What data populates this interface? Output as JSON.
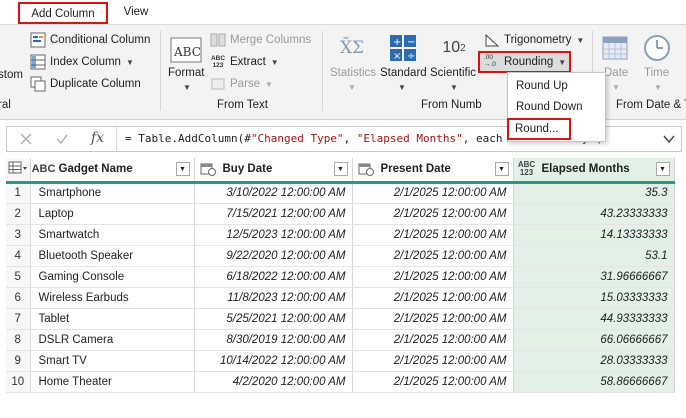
{
  "tabs": {
    "add_column": "Add Column",
    "view": "View"
  },
  "ribbon": {
    "general": {
      "custom_partial": "stom",
      "group_partial": "ral"
    },
    "column_items": {
      "conditional": "Conditional Column",
      "index": "Index Column",
      "duplicate": "Duplicate Column"
    },
    "from_text": {
      "format": "Format",
      "merge": "Merge Columns",
      "extract": "Extract",
      "parse": "Parse",
      "group": "From Text",
      "abc_top": "ABC",
      "abc_num": "123"
    },
    "from_number": {
      "statistics": "Statistics",
      "standard": "Standard",
      "scientific": "Scientific",
      "trigonometry": "Trigonometry",
      "rounding": "Rounding",
      "group": "From Numb",
      "sci_glyph": "10",
      "sci_exp": "2",
      "xo_glyph": "X̄Σ",
      "round_glyph_top": ".00",
      "round_glyph_bot": "→.0"
    },
    "from_date": {
      "date": "Date",
      "time": "Time",
      "group": "From Date & T"
    }
  },
  "dropdown": {
    "round_up": "Round Up",
    "round_down": "Round Down",
    "round": "Round..."
  },
  "formula_bar": {
    "fx": "fx",
    "prefix": "= Table.AddColumn(#",
    "arg1": "\"Changed Type\"",
    "sep1": ", ",
    "arg2": "\"Elapsed Months\"",
    "sep2": ", each Duration.Days("
  },
  "table": {
    "columns": [
      {
        "type": "ABC",
        "name": "Gadget Name"
      },
      {
        "type": "date",
        "name": "Buy Date"
      },
      {
        "type": "date",
        "name": "Present Date"
      },
      {
        "type": "ABC123",
        "name": "Elapsed Months"
      }
    ],
    "rows": [
      {
        "n": "1",
        "name": "Smartphone",
        "buy": "3/10/2022 12:00:00 AM",
        "present": "2/1/2025 12:00:00 AM",
        "months": "35.3"
      },
      {
        "n": "2",
        "name": "Laptop",
        "buy": "7/15/2021 12:00:00 AM",
        "present": "2/1/2025 12:00:00 AM",
        "months": "43.23333333"
      },
      {
        "n": "3",
        "name": "Smartwatch",
        "buy": "12/5/2023 12:00:00 AM",
        "present": "2/1/2025 12:00:00 AM",
        "months": "14.13333333"
      },
      {
        "n": "4",
        "name": "Bluetooth Speaker",
        "buy": "9/22/2020 12:00:00 AM",
        "present": "2/1/2025 12:00:00 AM",
        "months": "53.1"
      },
      {
        "n": "5",
        "name": "Gaming Console",
        "buy": "6/18/2022 12:00:00 AM",
        "present": "2/1/2025 12:00:00 AM",
        "months": "31.96666667"
      },
      {
        "n": "6",
        "name": "Wireless Earbuds",
        "buy": "11/8/2023 12:00:00 AM",
        "present": "2/1/2025 12:00:00 AM",
        "months": "15.03333333"
      },
      {
        "n": "7",
        "name": "Tablet",
        "buy": "5/25/2021 12:00:00 AM",
        "present": "2/1/2025 12:00:00 AM",
        "months": "44.93333333"
      },
      {
        "n": "8",
        "name": "DSLR Camera",
        "buy": "8/30/2019 12:00:00 AM",
        "present": "2/1/2025 12:00:00 AM",
        "months": "66.06666667"
      },
      {
        "n": "9",
        "name": "Smart TV",
        "buy": "10/14/2022 12:00:00 AM",
        "present": "2/1/2025 12:00:00 AM",
        "months": "28.03333333"
      },
      {
        "n": "10",
        "name": "Home Theater",
        "buy": "4/2/2020 12:00:00 AM",
        "present": "2/1/2025 12:00:00 AM",
        "months": "58.86666667"
      }
    ]
  },
  "colors": {
    "accent_red": "#e01010",
    "header_underline": "#1e9e8a",
    "numeric_column_bg": "#e2f0e6",
    "icon_blue": "#2b6cb0"
  }
}
